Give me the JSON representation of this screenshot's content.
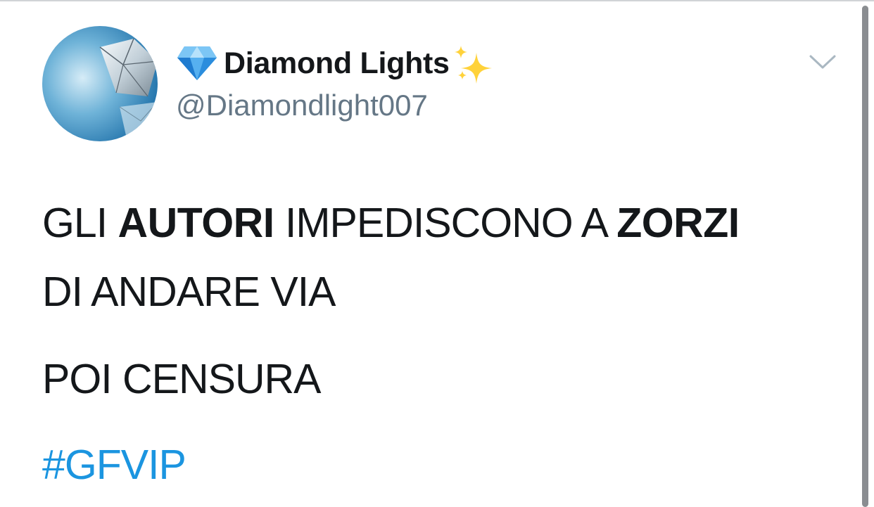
{
  "author": {
    "display_name": "Diamond Lights",
    "handle": "@Diamondlight007",
    "name_prefix_emoji": "gem-icon",
    "name_suffix_emoji": "sparkles-icon"
  },
  "tweet": {
    "line1": [
      {
        "text": "GLI ",
        "bold": false
      },
      {
        "text": "AUTORI",
        "bold": true
      },
      {
        "text": " IMPEDISCONO A ",
        "bold": false
      },
      {
        "text": "ZORZI",
        "bold": true
      }
    ],
    "line2": "DI ANDARE VIA",
    "line3": "POI CENSURA",
    "hashtag": "#GFVIP"
  },
  "colors": {
    "text": "#14171a",
    "handle": "#657786",
    "hashtag": "#1b95e0",
    "chevron": "#aab8c2"
  },
  "icons": {
    "menu": "chevron-down-icon"
  }
}
